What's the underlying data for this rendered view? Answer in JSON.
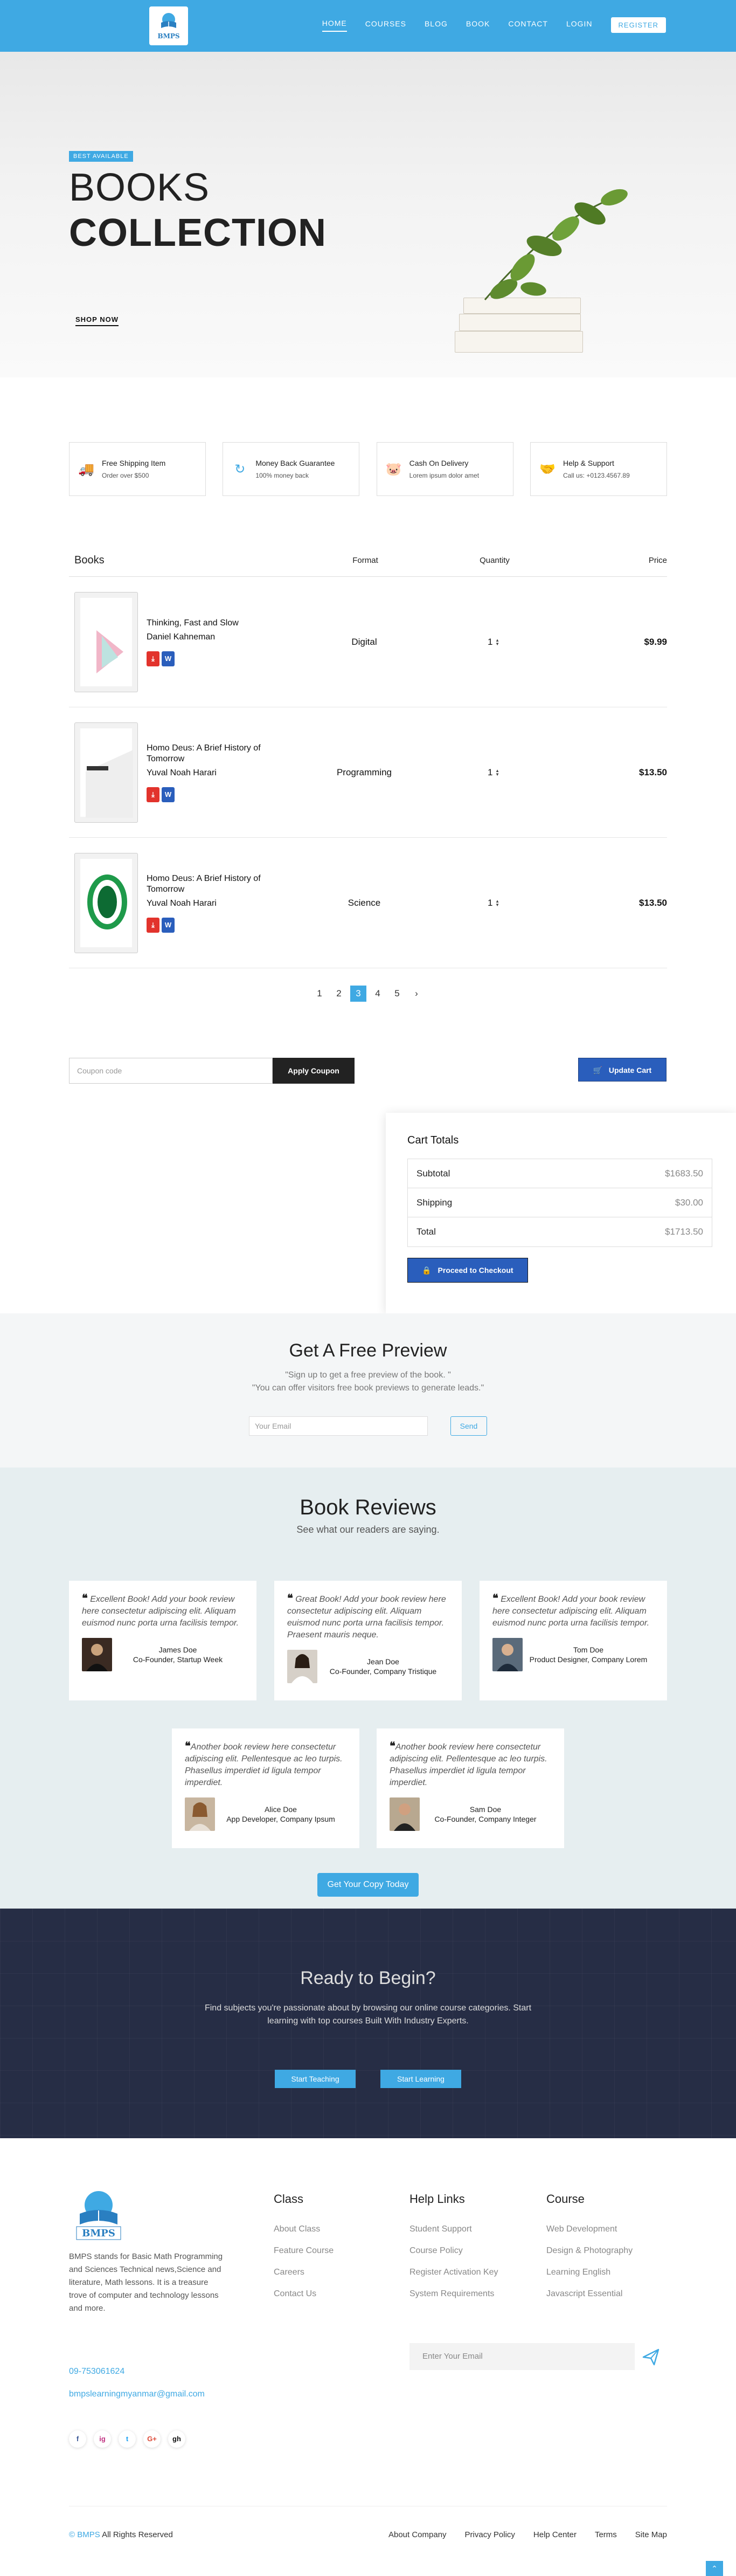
{
  "nav": {
    "logo_text": "BMPS",
    "items": [
      "HOME",
      "COURSES",
      "BLOG",
      "BOOK",
      "CONTACT",
      "LOGIN"
    ],
    "register": "REGISTER"
  },
  "hero": {
    "badge": "BEST AVAILABLE",
    "title_1": "BOOKS",
    "title_2": "COLLECTION",
    "shop": "SHOP NOW"
  },
  "features": [
    {
      "icon": "truck-icon",
      "title": "Free Shipping Item",
      "sub": "Order over $500"
    },
    {
      "icon": "refresh-icon",
      "title": "Money Back Guarantee",
      "sub": "100% money back"
    },
    {
      "icon": "piggy-bank-icon",
      "title": "Cash On Delivery",
      "sub": "Lorem ipsum dolor amet"
    },
    {
      "icon": "support-icon",
      "title": "Help & Support",
      "sub": "Call us: +0123.4567.89"
    }
  ],
  "books": {
    "headers": [
      "Books",
      "Format",
      "Quantity",
      "Price"
    ],
    "rows": [
      {
        "title": "Thinking, Fast and Slow",
        "author": "Daniel Kahneman",
        "format": "Digital",
        "qty": "1",
        "price": "$9.99"
      },
      {
        "title": "Homo Deus: A Brief History of Tomorrow",
        "author": "Yuval Noah Harari",
        "format": "Programming",
        "qty": "1",
        "price": "$13.50"
      },
      {
        "title": "Homo Deus: A Brief History of Tomorrow",
        "author": "Yuval Noah Harari",
        "format": "Science",
        "qty": "1",
        "price": "$13.50"
      }
    ]
  },
  "pager": {
    "pages": [
      "1",
      "2",
      "3",
      "4",
      "5"
    ],
    "active": "3",
    "next": "›"
  },
  "coupon": {
    "placeholder": "Coupon code",
    "apply": "Apply Coupon",
    "update": "Update Cart"
  },
  "cart": {
    "title": "Cart Totals",
    "subtotal_label": "Subtotal",
    "subtotal": "$1683.50",
    "shipping_label": "Shipping",
    "shipping": "$30.00",
    "total_label": "Total",
    "total": "$1713.50",
    "checkout": "Proceed to Checkout"
  },
  "preview": {
    "title": "Get A Free Preview",
    "line1": "\"Sign up to get a free preview of the book. \"",
    "line2": "\"You can offer visitors free book previews to generate leads.\"",
    "placeholder": "Your Email",
    "send": "Send"
  },
  "reviews": {
    "title": "Book Reviews",
    "sub": "See what our readers are saying.",
    "items": [
      {
        "quote": "Excellent Book! Add your book review here consectetur adipiscing elit. Aliquam euismod nunc porta urna facilisis tempor.",
        "name": "James Doe",
        "role": "Co-Founder, Startup Week"
      },
      {
        "quote": "Great Book! Add your book review here consectetur adipiscing elit. Aliquam euismod nunc porta urna facilisis tempor. Praesent mauris neque.",
        "name": "Jean Doe",
        "role": "Co-Founder, Company Tristique"
      },
      {
        "quote": "Excellent Book! Add your book review here consectetur adipiscing elit. Aliquam euismod nunc porta urna facilisis tempor.",
        "name": "Tom Doe",
        "role": "Product Designer, Company Lorem"
      },
      {
        "quote": "Another book review here consectetur adipiscing elit. Pellentesque ac leo turpis. Phasellus imperdiet id ligula tempor imperdiet.",
        "name": "Alice Doe",
        "role": "App Developer, Company Ipsum"
      },
      {
        "quote": "Another book review here consectetur adipiscing elit. Pellentesque ac leo turpis. Phasellus imperdiet id ligula tempor imperdiet.",
        "name": "Sam Doe",
        "role": "Co-Founder, Company Integer"
      }
    ],
    "cta": "Get Your Copy Today"
  },
  "ready": {
    "title": "Ready to Begin?",
    "text": "Find subjects you're passionate about by browsing our online course categories. Start learning with top courses Built With Industry Experts.",
    "teach": "Start Teaching",
    "learn": "Start Learning"
  },
  "footer": {
    "logo_text": "BMPS",
    "desc": "BMPS stands for Basic Math Programming and Sciences Technical news,Science and literature, Math lessons. It is a treasure trove of computer and technology lessons and more.",
    "phone": "09-753061624",
    "email": "bmpslearningmyanmar@gmail.com",
    "social": [
      "f",
      "ig",
      "t",
      "G+",
      "gh"
    ],
    "col1": {
      "title": "Class",
      "items": [
        "About Class",
        "Feature Course",
        "Careers",
        "Contact Us"
      ]
    },
    "col2": {
      "title": "Help Links",
      "items": [
        "Student Support",
        "Course Policy",
        "Register Activation Key",
        "System Requirements"
      ]
    },
    "col3": {
      "title": "Course",
      "items": [
        "Web Development",
        "Design & Photography",
        "Learning English",
        "Javascript Essential"
      ]
    },
    "subscribe_placeholder": "Enter Your Email",
    "copy_brand": "© BMPS",
    "copy_rest": " All Rights Reserved",
    "bottom_links": [
      "About Company",
      "Privacy Policy",
      "Help Center",
      "Terms",
      "Site Map"
    ]
  },
  "colors": {
    "accent": "#3fa9e3",
    "dark_blue": "#2a5ebc",
    "dark_bg": "#262d45"
  }
}
